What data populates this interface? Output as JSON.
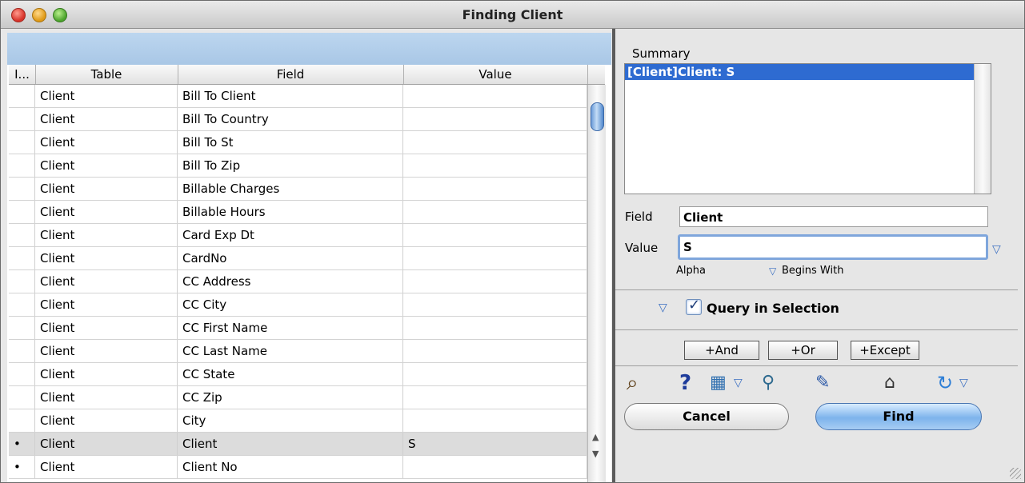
{
  "window": {
    "title": "Finding Client"
  },
  "grid": {
    "headers": {
      "indicator": "I...",
      "table": "Table",
      "field": "Field",
      "value": "Value"
    },
    "rows": [
      {
        "marker": "",
        "table": "Client",
        "field": "Bill To Client",
        "value": ""
      },
      {
        "marker": "",
        "table": "Client",
        "field": "Bill To Country",
        "value": ""
      },
      {
        "marker": "",
        "table": "Client",
        "field": "Bill To St",
        "value": ""
      },
      {
        "marker": "",
        "table": "Client",
        "field": "Bill To Zip",
        "value": ""
      },
      {
        "marker": "",
        "table": "Client",
        "field": "Billable Charges",
        "value": ""
      },
      {
        "marker": "",
        "table": "Client",
        "field": "Billable Hours",
        "value": ""
      },
      {
        "marker": "",
        "table": "Client",
        "field": "Card Exp Dt",
        "value": ""
      },
      {
        "marker": "",
        "table": "Client",
        "field": "CardNo",
        "value": ""
      },
      {
        "marker": "",
        "table": "Client",
        "field": "CC Address",
        "value": ""
      },
      {
        "marker": "",
        "table": "Client",
        "field": "CC City",
        "value": ""
      },
      {
        "marker": "",
        "table": "Client",
        "field": "CC First Name",
        "value": ""
      },
      {
        "marker": "",
        "table": "Client",
        "field": "CC Last Name",
        "value": ""
      },
      {
        "marker": "",
        "table": "Client",
        "field": "CC State",
        "value": ""
      },
      {
        "marker": "",
        "table": "Client",
        "field": "CC Zip",
        "value": ""
      },
      {
        "marker": "",
        "table": "Client",
        "field": "City",
        "value": ""
      },
      {
        "marker": "•",
        "table": "Client",
        "field": "Client",
        "value": "S"
      },
      {
        "marker": "•",
        "table": "Client",
        "field": "Client No",
        "value": ""
      }
    ]
  },
  "summary": {
    "label": "Summary",
    "line": "[Client]Client:  S"
  },
  "editor": {
    "field_label": "Field",
    "field_value": "Client",
    "value_label": "Value",
    "value_value": "S",
    "type_label": "Alpha",
    "operator_label": "Begins With"
  },
  "query": {
    "label": "Query in Selection",
    "checked": true
  },
  "logic_buttons": {
    "and": "+And",
    "or": "+Or",
    "except": "+Except"
  },
  "actions": {
    "cancel": "Cancel",
    "find": "Find"
  }
}
